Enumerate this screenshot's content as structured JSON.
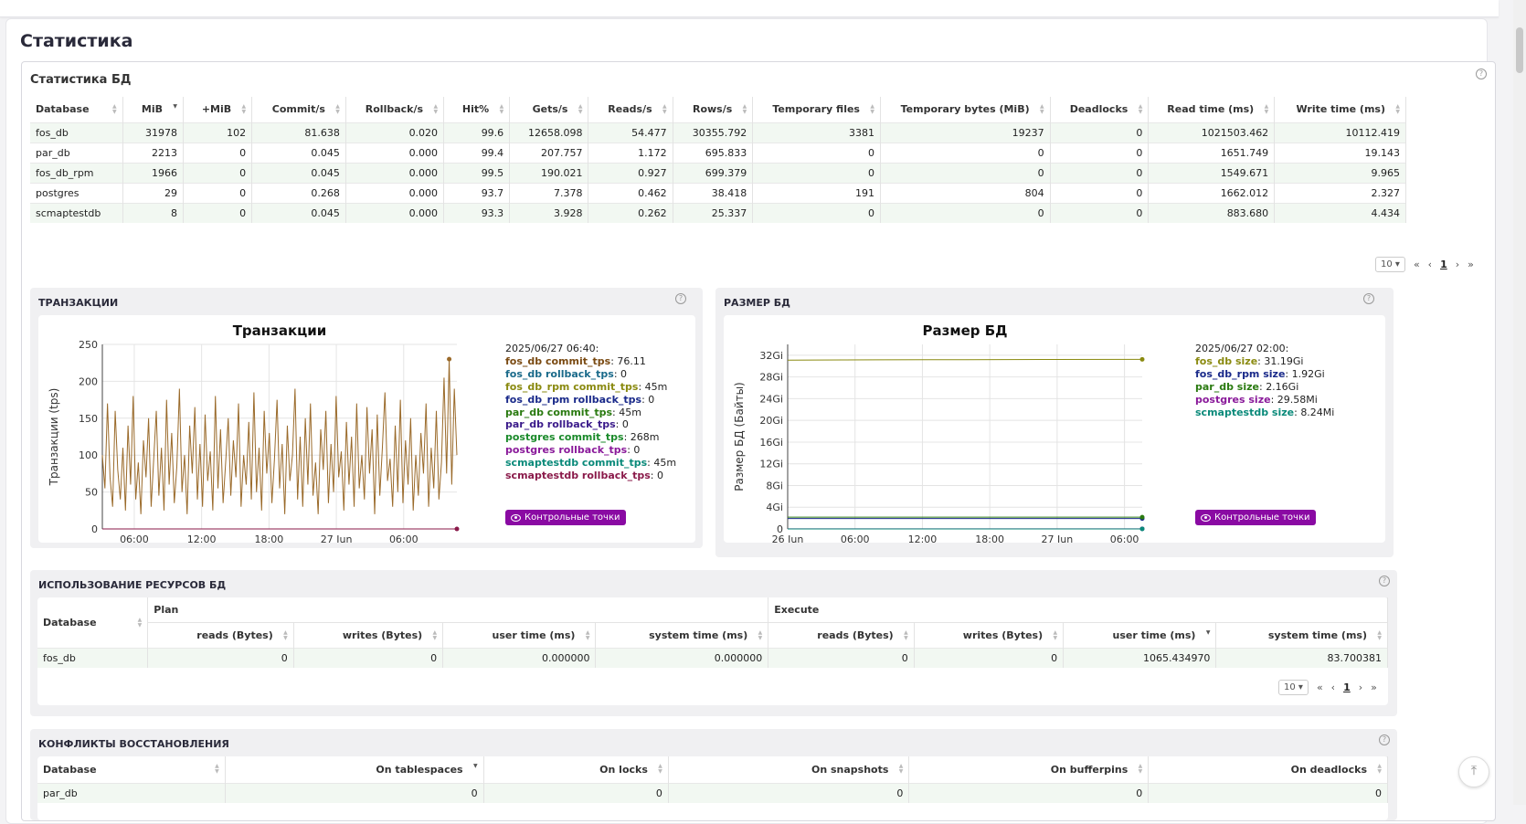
{
  "page": {
    "title": "Статистика"
  },
  "db_stats": {
    "title": "Статистика БД",
    "columns": [
      "Database",
      "MiB",
      "+MiB",
      "Commit/s",
      "Rollback/s",
      "Hit%",
      "Gets/s",
      "Reads/s",
      "Rows/s",
      "Temporary files",
      "Temporary bytes (MiB)",
      "Deadlocks",
      "Read time (ms)",
      "Write time (ms)"
    ],
    "rows": [
      [
        "fos_db",
        "31978",
        "102",
        "81.638",
        "0.020",
        "99.6",
        "12658.098",
        "54.477",
        "30355.792",
        "3381",
        "19237",
        "0",
        "1021503.462",
        "10112.419"
      ],
      [
        "par_db",
        "2213",
        "0",
        "0.045",
        "0.000",
        "99.4",
        "207.757",
        "1.172",
        "695.833",
        "0",
        "0",
        "0",
        "1651.749",
        "19.143"
      ],
      [
        "fos_db_rpm",
        "1966",
        "0",
        "0.045",
        "0.000",
        "99.5",
        "190.021",
        "0.927",
        "699.379",
        "0",
        "0",
        "0",
        "1549.671",
        "9.965"
      ],
      [
        "postgres",
        "29",
        "0",
        "0.268",
        "0.000",
        "93.7",
        "7.378",
        "0.462",
        "38.418",
        "191",
        "804",
        "0",
        "1662.012",
        "2.327"
      ],
      [
        "scmaptestdb",
        "8",
        "0",
        "0.045",
        "0.000",
        "93.3",
        "3.928",
        "0.262",
        "25.337",
        "0",
        "0",
        "0",
        "883.680",
        "4.434"
      ]
    ],
    "pager": {
      "size": "10",
      "first": "«",
      "prev": "‹",
      "page": "1",
      "next": "›",
      "last": "»"
    }
  },
  "transactions": {
    "panel_title": "ТРАНЗАКЦИИ",
    "legend_time": "2025/06/27 06:40:",
    "legend": [
      {
        "name": "fos_db commit_tps",
        "value": "76.11",
        "color": "#7a4a12"
      },
      {
        "name": "fos_db rollback_tps",
        "value": "0",
        "color": "#1a6a8a"
      },
      {
        "name": "fos_db_rpm commit_tps",
        "value": "45m",
        "color": "#8a8a10"
      },
      {
        "name": "fos_db_rpm rollback_tps",
        "value": "0",
        "color": "#1a2a8a"
      },
      {
        "name": "par_db commit_tps",
        "value": "45m",
        "color": "#2a7a10"
      },
      {
        "name": "par_db rollback_tps",
        "value": "0",
        "color": "#3a1a8a"
      },
      {
        "name": "postgres commit_tps",
        "value": "268m",
        "color": "#1a8a2a"
      },
      {
        "name": "postgres rollback_tps",
        "value": "0",
        "color": "#8a1a9a"
      },
      {
        "name": "scmaptestdb commit_tps",
        "value": "45m",
        "color": "#0a8a7a"
      },
      {
        "name": "scmaptestdb rollback_tps",
        "value": "0",
        "color": "#8a1a4a"
      }
    ],
    "button": "Контрольные точки"
  },
  "db_size": {
    "panel_title": "РАЗМЕР БД",
    "legend_time": "2025/06/27 02:00:",
    "legend": [
      {
        "name": "fos_db size",
        "value": "31.19Gi",
        "color": "#8a8a10"
      },
      {
        "name": "fos_db_rpm size",
        "value": "1.92Gi",
        "color": "#1a2a8a"
      },
      {
        "name": "par_db size",
        "value": "2.16Gi",
        "color": "#2a7a10"
      },
      {
        "name": "postgres size",
        "value": "29.58Mi",
        "color": "#8a1a9a"
      },
      {
        "name": "scmaptestdb size",
        "value": "8.24Mi",
        "color": "#0a8a7a"
      }
    ],
    "button": "Контрольные точки"
  },
  "chart_data": [
    {
      "type": "line",
      "title": "Транзакции",
      "ylabel": "Транзакции (tps)",
      "xlabel": "",
      "ylim": [
        0,
        250
      ],
      "yticks": [
        "0",
        "50",
        "100",
        "150",
        "200",
        "250"
      ],
      "xticks": [
        "06:00",
        "12:00",
        "18:00",
        "27 Jun",
        "06:00"
      ],
      "series": [
        {
          "name": "fos_db commit_tps",
          "color": "#9a6a2a",
          "values": [
            100,
            55,
            170,
            70,
            30,
            160,
            80,
            40,
            110,
            25,
            140,
            60,
            180,
            40,
            90,
            20,
            120,
            70,
            150,
            30,
            95,
            160,
            45,
            110,
            25,
            175,
            60,
            130,
            35,
            85,
            190,
            50,
            100,
            20,
            140,
            75,
            165,
            40,
            115,
            30,
            155,
            65,
            105,
            25,
            180,
            55,
            135,
            35,
            90,
            150,
            45,
            120,
            70,
            170,
            30,
            100,
            60,
            145,
            40,
            185,
            50,
            110,
            25,
            160,
            75,
            130,
            35,
            95,
            175,
            55,
            115,
            20,
            140,
            65,
            100,
            190,
            40,
            125,
            30,
            150,
            60,
            170,
            45,
            90,
            20,
            135,
            80,
            160,
            35,
            115,
            50,
            180,
            70,
            105,
            25,
            145,
            60,
            125,
            30,
            170,
            55,
            100,
            40,
            165,
            75,
            135,
            20,
            155,
            45,
            110,
            185,
            65,
            95,
            30,
            140,
            50,
            175,
            35,
            120,
            60,
            150,
            25,
            100,
            45,
            130,
            75,
            170,
            30,
            110,
            55,
            160,
            40,
            90,
            205,
            75,
            230,
            60,
            190,
            100
          ]
        },
        {
          "name": "fos_db rollback_tps",
          "color": "#8a1a4a",
          "values": [
            0,
            0,
            0,
            0,
            0
          ]
        }
      ]
    },
    {
      "type": "line",
      "title": "Размер БД",
      "ylabel": "Размер БД (Байты)",
      "xlabel": "",
      "ylim": [
        0,
        34
      ],
      "yticks": [
        "0",
        "4Gi",
        "8Gi",
        "12Gi",
        "16Gi",
        "20Gi",
        "24Gi",
        "28Gi",
        "32Gi"
      ],
      "xticks": [
        "26 Jun",
        "06:00",
        "12:00",
        "18:00",
        "27 Jun",
        "06:00"
      ],
      "series": [
        {
          "name": "fos_db size",
          "color": "#8a8a10",
          "values": [
            31.1,
            31.15,
            31.19,
            31.22,
            31.25
          ]
        },
        {
          "name": "fos_db_rpm size",
          "color": "#1a2a8a",
          "values": [
            1.92,
            1.92,
            1.92,
            1.92,
            1.92
          ]
        },
        {
          "name": "par_db size",
          "color": "#2a7a10",
          "values": [
            2.16,
            2.16,
            2.16,
            2.16,
            2.16
          ]
        },
        {
          "name": "postgres size",
          "color": "#8a1a9a",
          "values": [
            0.03,
            0.03,
            0.03,
            0.03,
            0.03
          ]
        },
        {
          "name": "scmaptestdb size",
          "color": "#0a8a7a",
          "values": [
            0.008,
            0.008,
            0.008,
            0.008,
            0.008
          ]
        }
      ]
    }
  ],
  "resources": {
    "panel_title": "ИСПОЛЬЗОВАНИЕ РЕСУРСОВ БД",
    "group_plan": "Plan",
    "group_execute": "Execute",
    "db_col": "Database",
    "columns": [
      "reads (Bytes)",
      "writes (Bytes)",
      "user time (ms)",
      "system time (ms)",
      "reads (Bytes)",
      "writes (Bytes)",
      "user time (ms)",
      "system time (ms)"
    ],
    "rows": [
      [
        "fos_db",
        "0",
        "0",
        "0.000000",
        "0.000000",
        "0",
        "0",
        "1065.434970",
        "83.700381"
      ]
    ],
    "pager": {
      "size": "10",
      "first": "«",
      "prev": "‹",
      "page": "1",
      "next": "›",
      "last": "»"
    }
  },
  "conflicts": {
    "panel_title": "КОНФЛИКТЫ ВОССТАНОВЛЕНИЯ",
    "columns": [
      "Database",
      "On tablespaces",
      "On locks",
      "On snapshots",
      "On bufferpins",
      "On deadlocks"
    ],
    "rows": [
      [
        "par_db",
        "0",
        "0",
        "0",
        "0",
        "0"
      ]
    ]
  }
}
